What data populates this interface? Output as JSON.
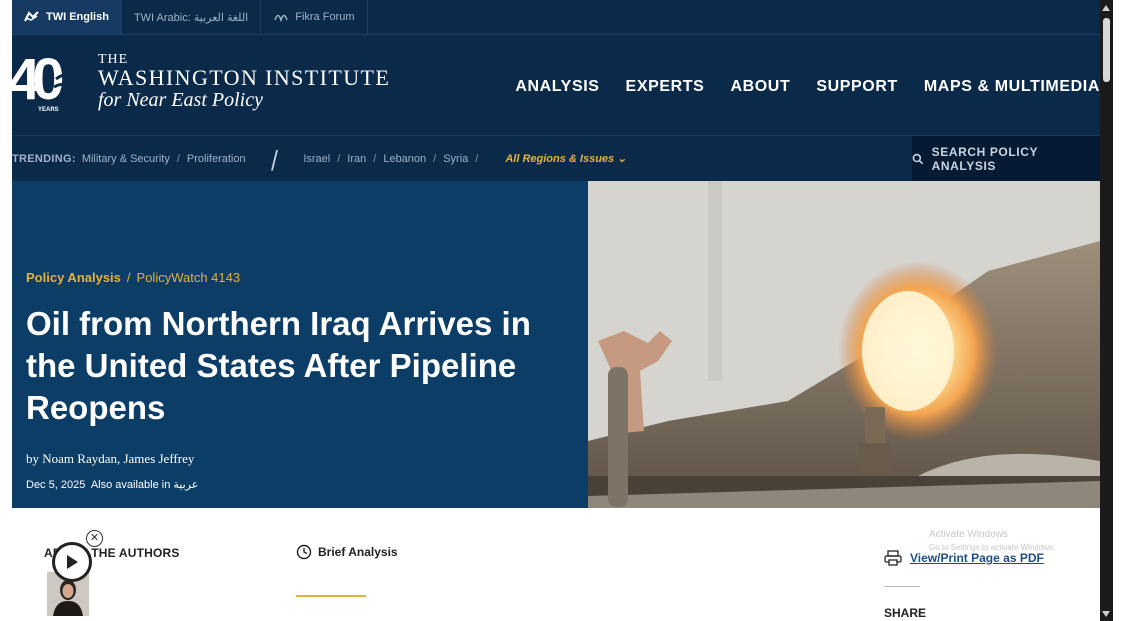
{
  "lang_bar": {
    "items": [
      {
        "label": "TWI English",
        "active": true
      },
      {
        "label": "TWI Arabic: اللغة العربية",
        "active": false
      },
      {
        "label": "Fikra Forum",
        "active": false
      }
    ]
  },
  "header": {
    "logo_number": "40",
    "logo_years": "YEARS",
    "brand_the": "THE",
    "brand_name": "WASHINGTON INSTITUTE",
    "brand_sub": "for Near East Policy",
    "nav": [
      "ANALYSIS",
      "EXPERTS",
      "ABOUT",
      "SUPPORT",
      "MAPS & MULTIMEDIA"
    ]
  },
  "trending": {
    "label": "TRENDING:",
    "topics": [
      "Military & Security",
      "Proliferation"
    ],
    "regions": [
      "Israel",
      "Iran",
      "Lebanon",
      "Syria"
    ],
    "all_regions": "All Regions & Issues ⌄",
    "search_label": "SEARCH POLICY ANALYSIS"
  },
  "article": {
    "category": "Policy Analysis",
    "series": "PolicyWatch 4143",
    "title": "Oil from Northern Iraq Arrives in the United States After Pipeline Reopens",
    "byline": "by Noam Raydan, James Jeffrey",
    "date": "Dec 5, 2025",
    "also_available": "Also available in",
    "also_available_lang": "عربية"
  },
  "body": {
    "authors_heading": "ABOUT THE AUTHORS",
    "brief_label": "Brief Analysis",
    "pdf_label": "View/Print Page as PDF",
    "share_label": "SHARE",
    "windows_title": "Activate Windows",
    "windows_sub": "Go to Settings to activate Windows."
  },
  "colors": {
    "navy": "#0b2a4a",
    "hero_blue": "#0c3d66",
    "gold": "#e2b23a",
    "link_blue": "#1d4f86"
  }
}
